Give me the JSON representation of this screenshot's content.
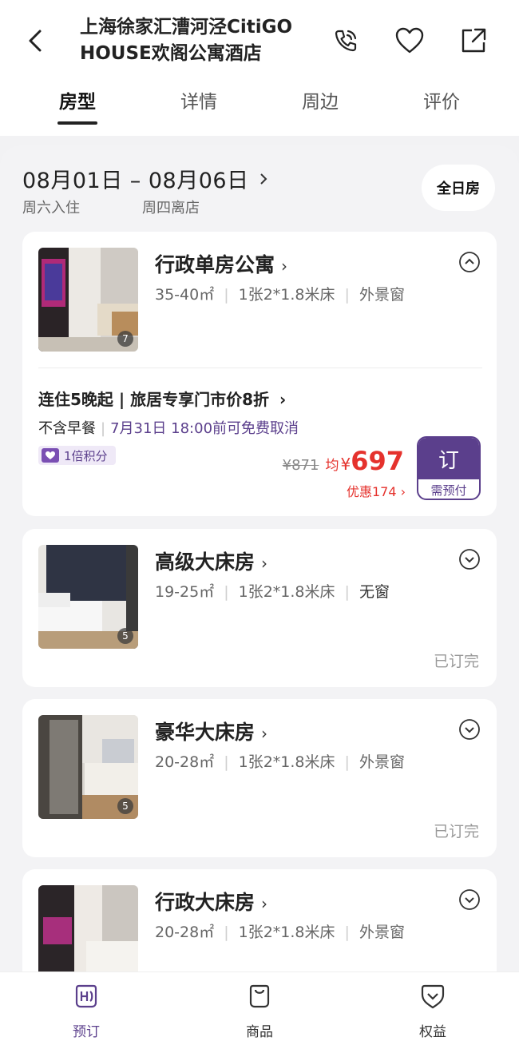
{
  "header": {
    "title": "上海徐家汇漕河泾CitiGO HOUSE欢阁公寓酒店",
    "icons": [
      "back-icon",
      "phone-icon",
      "heart-icon",
      "share-icon"
    ]
  },
  "tabs": [
    {
      "label": "房型",
      "active": true
    },
    {
      "label": "详情",
      "active": false
    },
    {
      "label": "周边",
      "active": false
    },
    {
      "label": "评价",
      "active": false
    }
  ],
  "dates": {
    "range": "08月01日 – 08月06日",
    "checkin_day": "周六入住",
    "checkout_day": "周四离店",
    "fullday_label": "全日房"
  },
  "rooms": [
    {
      "name": "行政单房公寓",
      "area": "35-40㎡",
      "bed": "1张2*1.8米床",
      "window": "外景窗",
      "image_count": "7",
      "expanded": true,
      "rate": {
        "title": "连住5晚起 | 旅居专享门市价8折",
        "breakfast": "不含早餐",
        "cancel": "7月31日 18:00前可免费取消",
        "points": "1倍积分",
        "old_price": "¥871",
        "avg_label": "均",
        "currency": "¥",
        "price": "697",
        "discount": "优惠174",
        "book_label": "订",
        "book_sub": "需预付"
      }
    },
    {
      "name": "高级大床房",
      "area": "19-25㎡",
      "bed": "1张2*1.8米床",
      "window": "无窗",
      "image_count": "5",
      "status": "已订完"
    },
    {
      "name": "豪华大床房",
      "area": "20-28㎡",
      "bed": "1张2*1.8米床",
      "window": "外景窗",
      "image_count": "5",
      "status": "已订完"
    },
    {
      "name": "行政大床房",
      "area": "20-28㎡",
      "bed": "1张2*1.8米床",
      "window": "外景窗",
      "image_count": ""
    }
  ],
  "bottom_nav": [
    {
      "label": "预订",
      "active": true
    },
    {
      "label": "商品",
      "active": false
    },
    {
      "label": "权益",
      "active": false
    }
  ],
  "colors": {
    "brand_purple": "#5b3f8c",
    "price_red": "#e5322d"
  }
}
